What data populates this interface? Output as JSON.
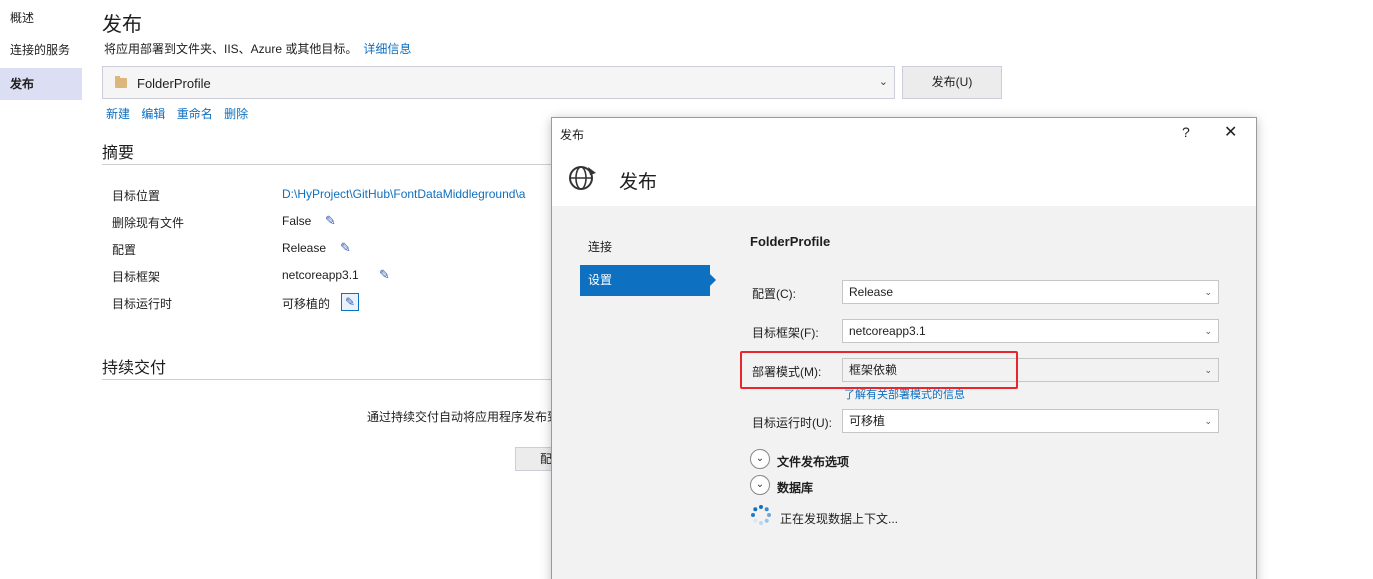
{
  "nav": {
    "items": [
      {
        "label": "概述"
      },
      {
        "label": "连接的服务"
      },
      {
        "label": "发布"
      }
    ]
  },
  "main": {
    "title": "发布",
    "subtitle": "将应用部署到文件夹、IIS、Azure 或其他目标。",
    "more_info_link": "详细信息",
    "profile": "FolderProfile",
    "publish_button": "发布(U)",
    "actions": [
      "新建",
      "编辑",
      "重命名",
      "删除"
    ],
    "summary_title": "摘要",
    "summary": [
      {
        "label": "目标位置",
        "value": "D:\\HyProject\\GitHub\\FontDataMiddleground\\a"
      },
      {
        "label": "删除现有文件",
        "value": "False"
      },
      {
        "label": "配置",
        "value": "Release"
      },
      {
        "label": "目标框架",
        "value": "netcoreapp3.1"
      },
      {
        "label": "目标运行时",
        "value": "可移植的"
      }
    ],
    "cd_title": "持续交付",
    "cd_text": "通过持续交付自动将应用程序发布到",
    "cd_button": "配"
  },
  "dialog": {
    "window_title": "发布",
    "help": "?",
    "close": "✕",
    "heading": "发布",
    "nav": [
      {
        "label": "连接"
      },
      {
        "label": "设置"
      }
    ],
    "profile_name": "FolderProfile",
    "fields": {
      "config": {
        "label": "配置(C):",
        "value": "Release"
      },
      "framework": {
        "label": "目标框架(F):",
        "value": "netcoreapp3.1"
      },
      "deploy_mode": {
        "label": "部署模式(M):",
        "value": "框架依赖"
      },
      "runtime": {
        "label": "目标运行时(U):",
        "value": "可移植"
      }
    },
    "learn_link": "了解有关部署模式的信息",
    "expanders": [
      "文件发布选项",
      "数据库"
    ],
    "status": "正在发现数据上下文..."
  },
  "colors": {
    "accent": "#0e70c0",
    "highlight": "#e8262b",
    "nav_active": "#dcdff3"
  }
}
